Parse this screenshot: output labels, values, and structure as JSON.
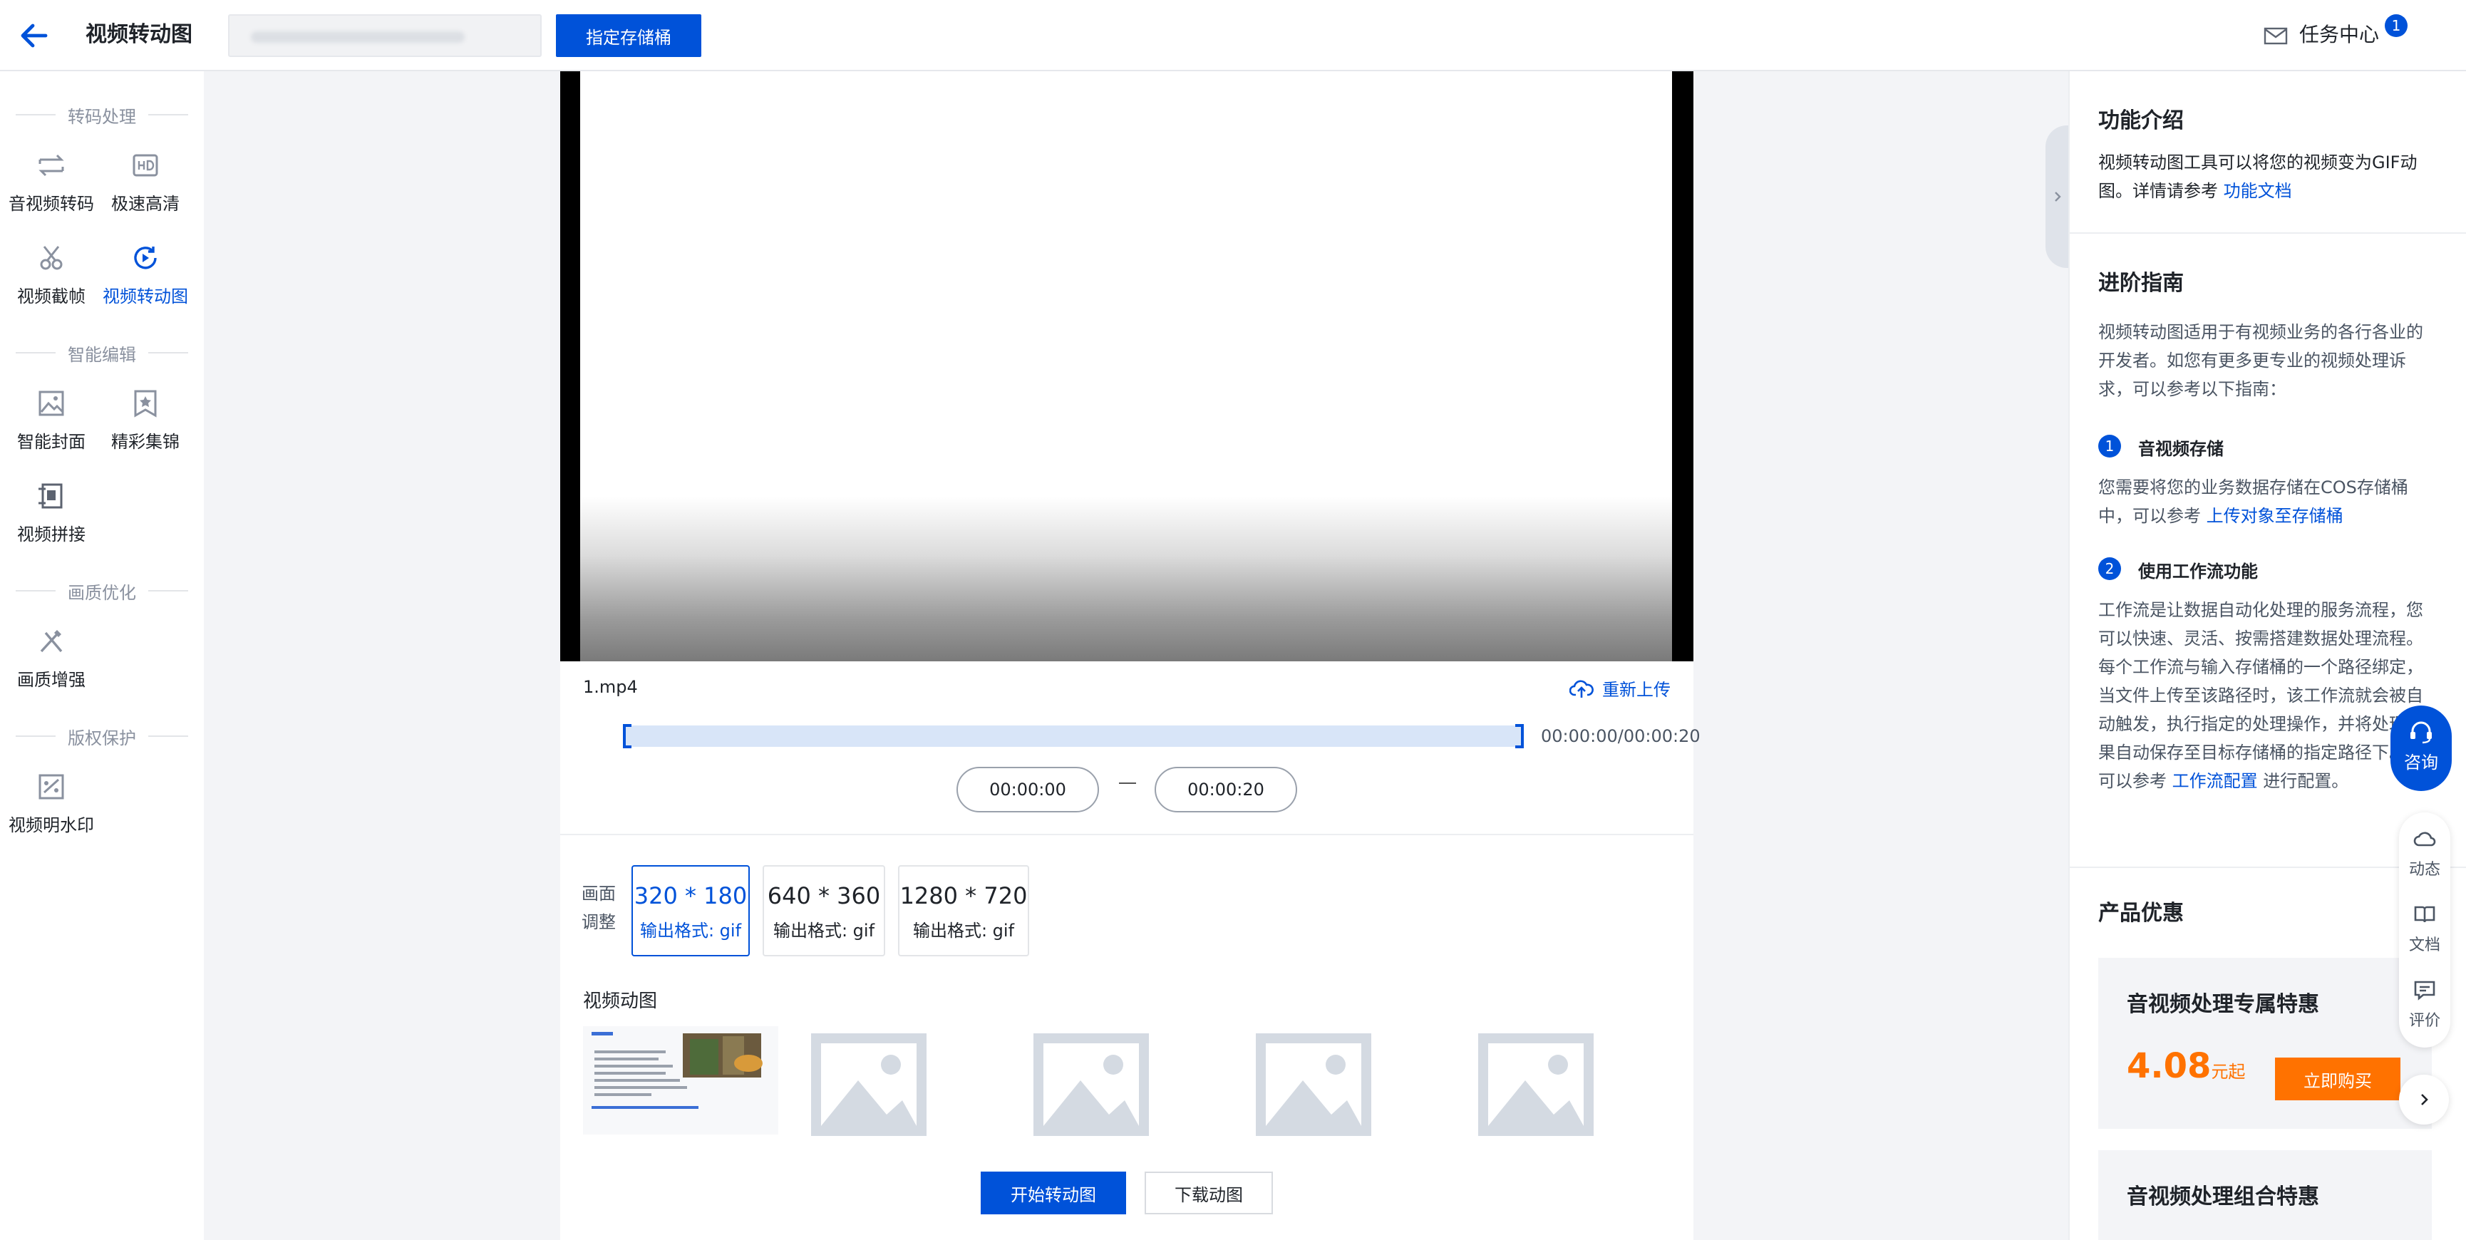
{
  "header": {
    "title": "视频转动图",
    "bucket_button": "指定存储桶",
    "task_center": "任务中心",
    "task_badge": "1"
  },
  "sidebar": {
    "sections": [
      {
        "label": "转码处理",
        "items": [
          {
            "label": "音视频转码"
          },
          {
            "label": "极速高清"
          },
          {
            "label": "视频截帧"
          },
          {
            "label": "视频转动图",
            "active": true
          }
        ]
      },
      {
        "label": "智能编辑",
        "items": [
          {
            "label": "智能封面"
          },
          {
            "label": "精彩集锦"
          },
          {
            "label": "视频拼接"
          }
        ]
      },
      {
        "label": "画质优化",
        "items": [
          {
            "label": "画质增强"
          }
        ]
      },
      {
        "label": "版权保护",
        "items": [
          {
            "label": "视频明水印"
          }
        ]
      }
    ]
  },
  "editor": {
    "file_name": "1.mp4",
    "reupload": "重新上传",
    "time_range": "00:00:00/00:00:20",
    "start_time": "00:00:00",
    "end_time": "00:00:20",
    "adjust_label_1": "画面",
    "adjust_label_2": "调整",
    "resolutions": [
      {
        "size": "320 * 180",
        "format": "输出格式: gif",
        "selected": true
      },
      {
        "size": "640 * 360",
        "format": "输出格式: gif"
      },
      {
        "size": "1280 * 720",
        "format": "输出格式: gif"
      }
    ],
    "gif_label": "视频动图",
    "start_button": "开始转动图",
    "download_button": "下载动图"
  },
  "right": {
    "intro_title": "功能介绍",
    "intro_text": "视频转动图工具可以将您的视频变为GIF动图。详情请参考 ",
    "intro_link": "功能文档",
    "guide_title": "进阶指南",
    "guide_text": "视频转动图适用于有视频业务的各行各业的开发者。如您有更多更专业的视频处理诉求，可以参考以下指南：",
    "steps": [
      {
        "num": "1",
        "title": "音视频存储",
        "text": "您需要将您的业务数据存储在COS存储桶中，可以参考 ",
        "link": "上传对象至存储桶",
        "after": ""
      },
      {
        "num": "2",
        "title": "使用工作流功能",
        "text": "工作流是让数据自动化处理的服务流程，您可以快速、灵活、按需搭建数据处理流程。每个工作流与输入存储桶的一个路径绑定，当文件上传至该路径时，该工作流就会被自动触发，执行指定的处理操作，并将处理结果自动保存至目标存储桶的指定路径下。您可以参考 ",
        "link": "工作流配置",
        "after": " 进行配置。"
      }
    ],
    "promo_title": "产品优惠",
    "promos": [
      {
        "title": "音视频处理专属特惠",
        "price": "4.08",
        "unit": "元起",
        "buy": "立即购买"
      },
      {
        "title": "音视频处理组合特惠"
      }
    ]
  },
  "floating": {
    "consult": "咨询",
    "tools": [
      "动态",
      "文档",
      "评价"
    ]
  },
  "colors": {
    "brand": "#0052d9",
    "orange": "#ff7200",
    "placeholder": "#d4dae2"
  }
}
